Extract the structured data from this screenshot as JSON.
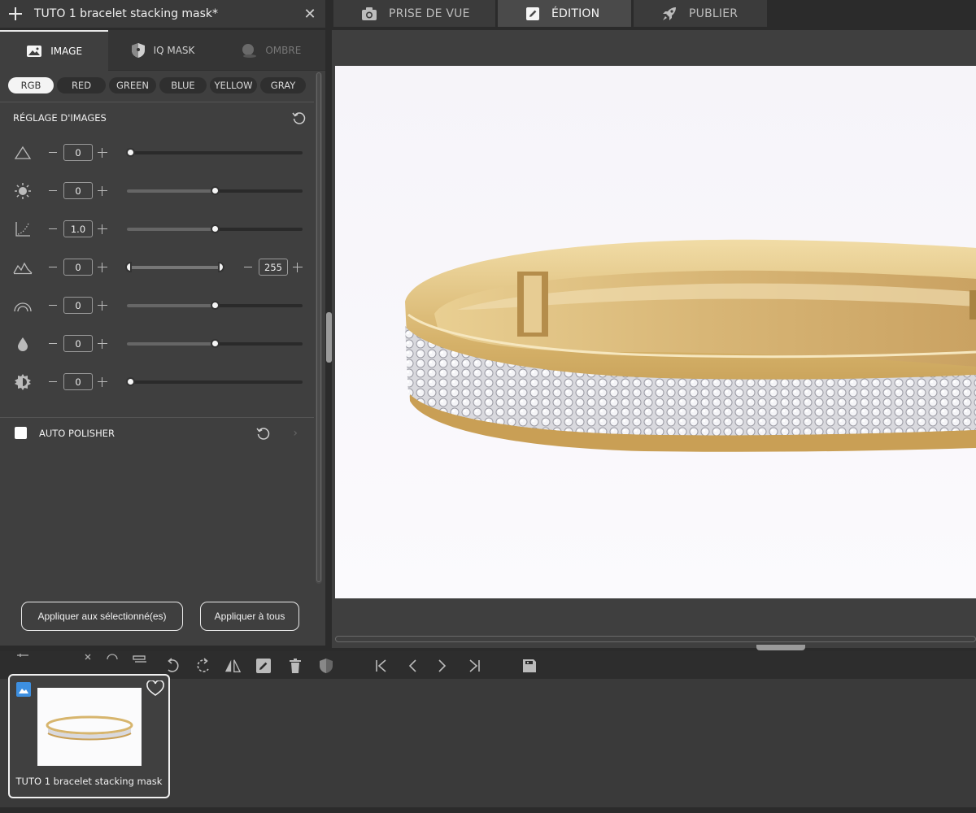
{
  "project": {
    "title": "TUTO 1 bracelet stacking mask*"
  },
  "top_tabs": [
    {
      "label": "PRISE DE VUE",
      "icon": "camera-icon"
    },
    {
      "label": "ÉDITION",
      "icon": "pencil-icon",
      "active": true
    },
    {
      "label": "PUBLIER",
      "icon": "rocket-icon"
    }
  ],
  "panel_tabs": [
    {
      "label": "IMAGE",
      "icon": "image-icon",
      "active": true
    },
    {
      "label": "IQ MASK",
      "icon": "shield-icon"
    },
    {
      "label": "OMBRE",
      "icon": "shadow-icon",
      "disabled": true
    }
  ],
  "channels": [
    "RGB",
    "RED",
    "GREEN",
    "BLUE",
    "YELLOW",
    "GRAY"
  ],
  "active_channel": "RGB",
  "adjustments": {
    "title": "RÉGLAGE D'IMAGES",
    "rows": [
      {
        "icon": "exposure-triangle-icon",
        "value": "0",
        "level": 0.02
      },
      {
        "icon": "brightness-sun-icon",
        "value": "0",
        "level": 0.5
      },
      {
        "icon": "gamma-curve-icon",
        "value": "1.0",
        "level": 0.5
      },
      {
        "icon": "levels-histogram-icon",
        "value": "0",
        "max_value": "255",
        "range": [
          0,
          1
        ]
      },
      {
        "icon": "contrast-arc-icon",
        "value": "0",
        "level": 0.5
      },
      {
        "icon": "saturation-drop-icon",
        "value": "0",
        "level": 0.5
      },
      {
        "icon": "sharpness-gear-icon",
        "value": "0",
        "level": 0.02
      }
    ]
  },
  "auto_polisher": {
    "label": "AUTO POLISHER",
    "checked": false
  },
  "buttons": {
    "apply_selected": "Appliquer aux sélectionné(es)",
    "apply_all": "Appliquer à tous"
  },
  "filmstrip": [
    {
      "label": "TUTO 1 bracelet stacking mask",
      "favorite": false
    }
  ],
  "colors": {
    "panel_bg": "#3f3f3f",
    "toolbar_bg": "#2d2d2d",
    "accent_blue": "#3d8fe0",
    "gold": "#d7b56d"
  }
}
